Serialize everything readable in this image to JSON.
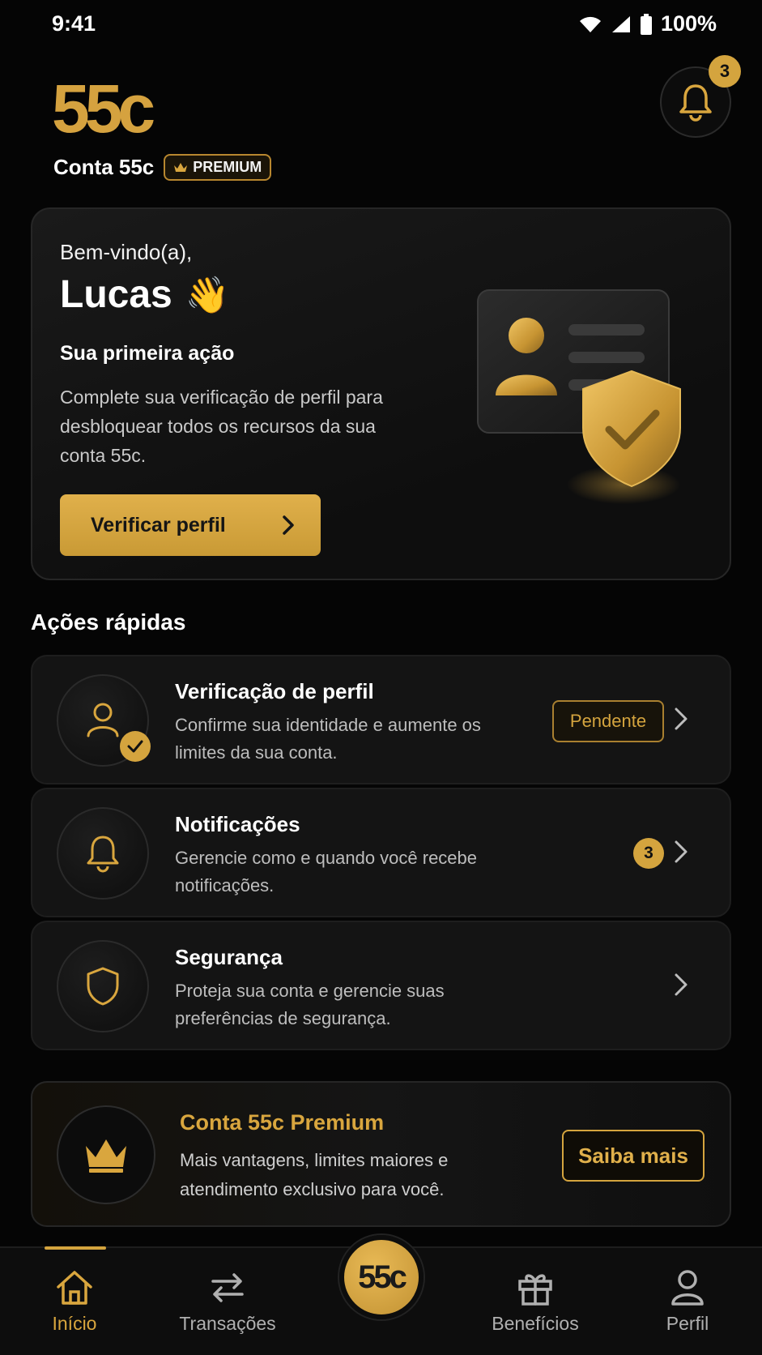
{
  "status_bar": {
    "time": "9:41",
    "battery": "100%"
  },
  "header": {
    "logo": "55c",
    "account_name": "Conta 55c",
    "premium_label": "PREMIUM",
    "notification_count": "3"
  },
  "welcome": {
    "greeting": "Bem-vindo(a),",
    "name": "Lucas",
    "wave_emoji": "👋",
    "first_action": "Sua primeira ação",
    "description": "Complete sua verificação de perfil para desbloquear todos os recursos da sua conta 55c.",
    "button_label": "Verificar perfil"
  },
  "quick_actions": {
    "title": "Ações rápidas",
    "items": [
      {
        "title": "Verificação de perfil",
        "desc": "Confirme sua identidade e aumente os limites da sua conta.",
        "badge": "Pendente",
        "icon": "user-verify-icon"
      },
      {
        "title": "Notificações",
        "desc": "Gerencie como e quando você recebe notificações.",
        "count": "3",
        "icon": "bell-icon"
      },
      {
        "title": "Segurança",
        "desc": "Proteja sua conta e gerencie suas preferências de segurança.",
        "icon": "shield-icon"
      }
    ]
  },
  "premium": {
    "title": "Conta 55c Premium",
    "desc": "Mais vantagens, limites maiores e atendimento exclusivo para você.",
    "button_label": "Saiba mais"
  },
  "bottom_nav": {
    "items": [
      {
        "label": "Início",
        "icon": "home-icon",
        "active": true
      },
      {
        "label": "Transações",
        "icon": "transfer-icon"
      },
      {
        "label": "55c",
        "icon": "logo-center"
      },
      {
        "label": "Benefícios",
        "icon": "gift-icon"
      },
      {
        "label": "Perfil",
        "icon": "person-icon"
      }
    ]
  },
  "colors": {
    "accent": "#d4a43e",
    "background": "#050505",
    "card": "#141414"
  }
}
